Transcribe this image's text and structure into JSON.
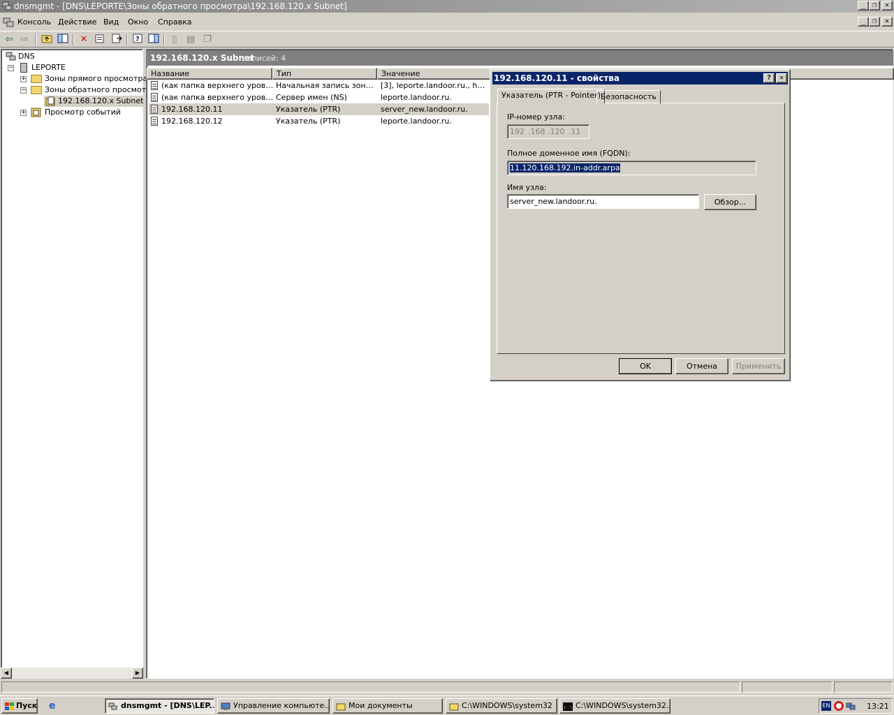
{
  "window": {
    "title": "dnsmgmt - [DNS\\LEPORTE\\Зоны обратного просмотра\\192.168.120.x Subnet]"
  },
  "menu": [
    "Консоль",
    "Действие",
    "Вид",
    "Окно",
    "Справка"
  ],
  "tree": {
    "root": "DNS",
    "server": "LEPORTE",
    "forward_zones": "Зоны прямого просмотра",
    "reverse_zones": "Зоны обратного просмотра",
    "subnet": "192.168.120.x Subnet",
    "event_viewer": "Просмотр событий"
  },
  "list": {
    "title": "192.168.120.x Subnet",
    "count": "записей: 4",
    "columns": [
      "Название",
      "Тип",
      "Значение"
    ],
    "rows": [
      {
        "name": "(как папка верхнего уровня)",
        "type": "Начальная запись зоны ...",
        "value": "[3], leporte.landoor.ru., ho..."
      },
      {
        "name": "(как папка верхнего уровня)",
        "type": "Сервер имен (NS)",
        "value": "leporte.landoor.ru."
      },
      {
        "name": "192.168.120.11",
        "type": "Указатель (PTR)",
        "value": "server_new.landoor.ru."
      },
      {
        "name": "192.168.120.12",
        "type": "Указатель (PTR)",
        "value": "leporte.landoor.ru."
      }
    ]
  },
  "dialog": {
    "title": "192.168.120.11 - свойства",
    "help": "?",
    "tabs": [
      "Указатель (PTR - Pointer)",
      "Безопасность"
    ],
    "ip_label": "IP-номер узла:",
    "ip_octets": [
      "192",
      ".168",
      ".120",
      ".11"
    ],
    "fqdn_label": "Полное доменное имя (FQDN):",
    "fqdn_value": "11.120.168.192.in-addr.arpa",
    "host_label": "Имя узла:",
    "host_value": "server_new.landoor.ru.",
    "browse": "Обзор...",
    "ok": "OK",
    "cancel": "Отмена",
    "apply": "Применить"
  },
  "taskbar": {
    "start": "Пуск",
    "tasks": [
      "dnsmgmt - [DNS\\LEP...",
      "Управление компьюте...",
      "Мои документы",
      "C:\\WINDOWS\\system32",
      "C:\\WINDOWS\\system32..."
    ],
    "lang": "EN",
    "clock": "13:21"
  },
  "colors": {
    "dialog_title_bg": "#0a246a",
    "inactive_title": "#808080",
    "selection": "#0a246a"
  }
}
